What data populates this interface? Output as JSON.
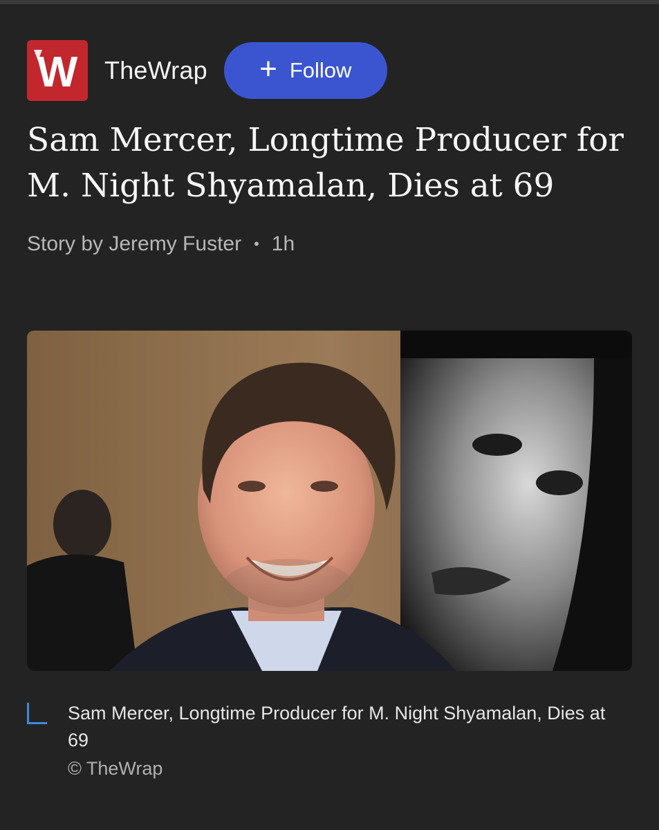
{
  "source": {
    "logo_letter": "W",
    "name": "TheWrap",
    "logo_color": "#c1272d"
  },
  "follow": {
    "icon": "+",
    "label": "Follow",
    "color": "#3b55d1"
  },
  "article": {
    "headline": "Sam Mercer, Longtime Producer for M. Night Shyamalan, Dies at 69",
    "byline": "Story by Jeremy Fuster",
    "separator": "•",
    "time": "1h"
  },
  "image": {
    "caption": "Sam Mercer, Longtime Producer for M. Night Shyamalan, Dies at 69",
    "credit": "© TheWrap"
  },
  "colors": {
    "background": "#232323",
    "caption_accent": "#3c8ae0"
  }
}
